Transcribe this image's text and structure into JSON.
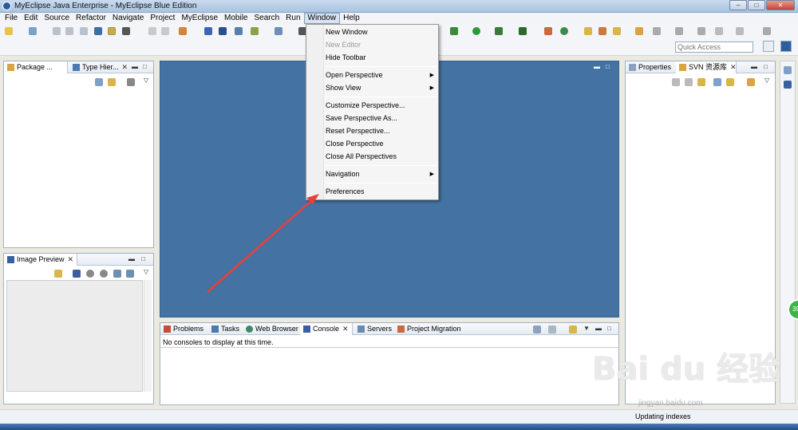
{
  "window": {
    "title": "MyEclipse Java Enterprise - MyEclipse Blue Edition",
    "min": "–",
    "max": "□",
    "close": "✕"
  },
  "menubar": [
    "File",
    "Edit",
    "Source",
    "Refactor",
    "Navigate",
    "Project",
    "MyEclipse",
    "Mobile",
    "Search",
    "Run",
    "Window",
    "Help"
  ],
  "toolbar": {
    "quick_access_placeholder": "Quick Access"
  },
  "package_panel": {
    "tabs": [
      "Package ...",
      "Type Hier..."
    ]
  },
  "image_preview": {
    "tab": "Image Preview"
  },
  "right_panel": {
    "tabs": [
      "Properties",
      "SVN 资源库"
    ]
  },
  "console_panel": {
    "tabs": [
      "Problems",
      "Tasks",
      "Web Browser",
      "Console",
      "Servers",
      "Project Migration"
    ],
    "message": "No consoles to display at this time."
  },
  "window_menu": {
    "items": [
      {
        "label": "New Window",
        "disabled": false,
        "submenu": false
      },
      {
        "label": "New Editor",
        "disabled": true,
        "submenu": false
      },
      {
        "label": "Hide Toolbar",
        "disabled": false,
        "submenu": false
      },
      {
        "label": "Open Perspective",
        "disabled": false,
        "submenu": true
      },
      {
        "label": "Show View",
        "disabled": false,
        "submenu": true
      },
      {
        "label": "Customize Perspective...",
        "disabled": false,
        "submenu": false
      },
      {
        "label": "Save Perspective As...",
        "disabled": false,
        "submenu": false
      },
      {
        "label": "Reset Perspective...",
        "disabled": false,
        "submenu": false
      },
      {
        "label": "Close Perspective",
        "disabled": false,
        "submenu": false
      },
      {
        "label": "Close All Perspectives",
        "disabled": false,
        "submenu": false
      },
      {
        "label": "Navigation",
        "disabled": false,
        "submenu": true
      },
      {
        "label": "Preferences",
        "disabled": false,
        "submenu": false
      }
    ],
    "submenu_arrow": "▶"
  },
  "status": {
    "text": "Updating indexes"
  },
  "overlay": {
    "badge": "39",
    "watermark": "Bai du 经验",
    "watermark_url": "jingyan.baidu.com"
  },
  "colors": {
    "editor_bg": "#4472a2",
    "arrow": "#e8403a"
  }
}
